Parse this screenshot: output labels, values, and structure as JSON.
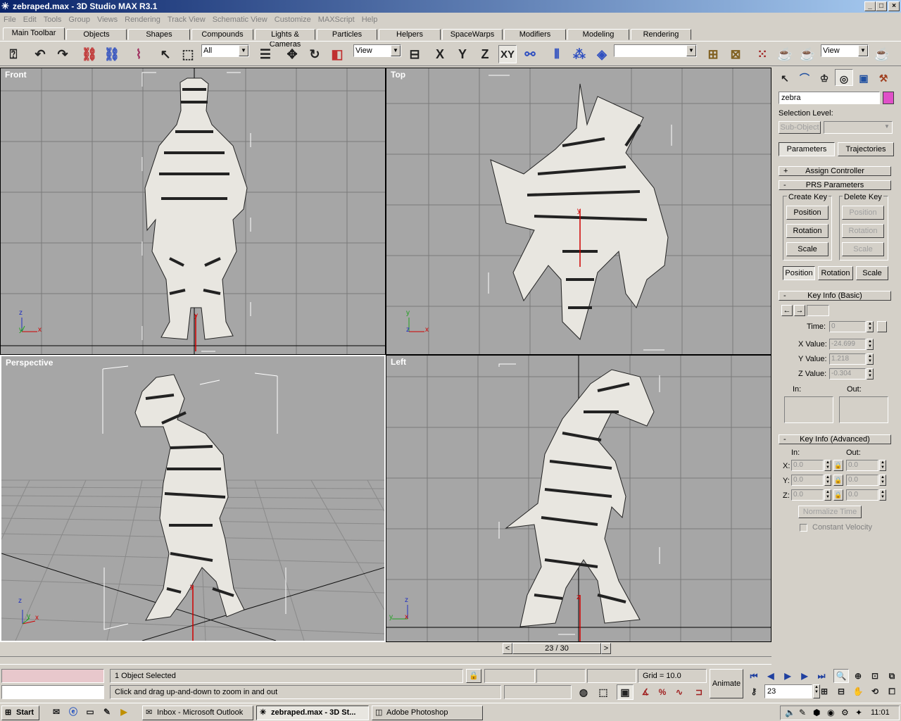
{
  "window": {
    "title": "zebraped.max - 3D Studio MAX R3.1",
    "min": "_",
    "max": "□",
    "close": "×"
  },
  "menu": [
    "File",
    "Edit",
    "Tools",
    "Group",
    "Views",
    "Rendering",
    "Track View",
    "Schematic View",
    "Customize",
    "MAXScript",
    "Help"
  ],
  "tabs": [
    "Main Toolbar",
    "Objects",
    "Shapes",
    "Compounds",
    "Lights & Cameras",
    "Particles",
    "Helpers",
    "SpaceWarps",
    "Modifiers",
    "Modeling",
    "Rendering"
  ],
  "toolbar": {
    "selection_filter": "All",
    "ref_coord": "View",
    "axis_x": "X",
    "axis_y": "Y",
    "axis_z": "Z",
    "axis_xy": "XY",
    "named_selection": "",
    "render_view": "View"
  },
  "viewports": {
    "front": {
      "label": "Front",
      "axes": {
        "a": "z",
        "b": "y",
        "c": "x"
      }
    },
    "top": {
      "label": "Top",
      "axes": {
        "a": "y",
        "b": "z",
        "c": "x"
      }
    },
    "perspective": {
      "label": "Perspective",
      "axes": {
        "a": "z",
        "b": "y",
        "c": "x"
      }
    },
    "left": {
      "label": "Left",
      "axes": {
        "a": "z",
        "b": "y",
        "c": "x"
      }
    }
  },
  "panel": {
    "object_name": "zebra",
    "object_color": "#e050c8",
    "selection_level_label": "Selection Level:",
    "sub_object_label": "Sub-Object",
    "parameters_btn": "Parameters",
    "trajectories_btn": "Trajectories",
    "assign_controller": {
      "sign": "+",
      "title": "Assign Controller"
    },
    "prs": {
      "sign": "-",
      "title": "PRS Parameters",
      "create_key": "Create Key",
      "delete_key": "Delete Key",
      "position": "Position",
      "rotation": "Rotation",
      "scale": "Scale"
    },
    "key_basic": {
      "sign": "-",
      "title": "Key Info (Basic)",
      "prev": "←",
      "next": "→",
      "time_label": "Time:",
      "time_value": "0",
      "x_label": "X Value:",
      "x_value": "-24.699",
      "y_label": "Y Value:",
      "y_value": "1.218",
      "z_label": "Z Value:",
      "z_value": "-0.304",
      "in_label": "In:",
      "out_label": "Out:"
    },
    "key_adv": {
      "sign": "-",
      "title": "Key Info (Advanced)",
      "in_label": "In:",
      "out_label": "Out:",
      "x": "X:",
      "y": "Y:",
      "z": "Z:",
      "val": "0.0",
      "normalize": "Normalize Time",
      "constant_velocity": "Constant Velocity"
    }
  },
  "timeline": {
    "frame": "23 / 30",
    "prev": "<",
    "next": ">"
  },
  "status": {
    "selected": "1 Object Selected",
    "prompt": "Click and drag up-and-down to zoom in and out",
    "grid": "Grid = 10.0",
    "animate": "Animate",
    "frame_field": "23"
  },
  "taskbar": {
    "start": "Start",
    "tasks": [
      "Inbox - Microsoft Outlook",
      "zebraped.max - 3D St...",
      "Adobe Photoshop"
    ],
    "clock": "11:01"
  }
}
